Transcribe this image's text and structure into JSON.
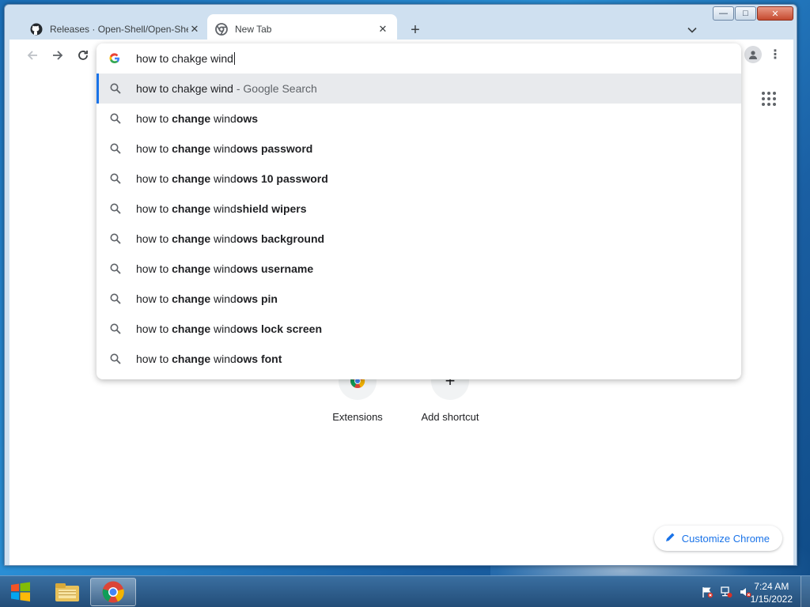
{
  "window": {
    "tabs": [
      {
        "title": "Releases · Open-Shell/Open-She",
        "icon": "github-icon",
        "active": false
      },
      {
        "title": "New Tab",
        "icon": "chrome-icon",
        "active": true
      }
    ],
    "caption": {
      "minimize": "—",
      "maximize": "□",
      "close": "✕"
    }
  },
  "omnibox": {
    "text": "how to chakge wind",
    "suggestions": [
      {
        "plain": "how to chakge wind",
        "bold": "",
        "tail": "",
        "suffix": " - Google Search",
        "selected": true
      },
      {
        "plain": "how to ",
        "bold": "change",
        "tail": " wind",
        "suffix_bold": "ows"
      },
      {
        "plain": "how to ",
        "bold": "change",
        "tail": " wind",
        "suffix_bold": "ows password"
      },
      {
        "plain": "how to ",
        "bold": "change",
        "tail": " wind",
        "suffix_bold": "ows 10 password"
      },
      {
        "plain": "how to ",
        "bold": "change",
        "tail": " wind",
        "suffix_bold": "shield wipers"
      },
      {
        "plain": "how to ",
        "bold": "change",
        "tail": " wind",
        "suffix_bold": "ows background"
      },
      {
        "plain": "how to ",
        "bold": "change",
        "tail": " wind",
        "suffix_bold": "ows username"
      },
      {
        "plain": "how to ",
        "bold": "change",
        "tail": " wind",
        "suffix_bold": "ows pin"
      },
      {
        "plain": "how to ",
        "bold": "change",
        "tail": " wind",
        "suffix_bold": "ows lock screen"
      },
      {
        "plain": "how to ",
        "bold": "change",
        "tail": " wind",
        "suffix_bold": "ows font"
      }
    ]
  },
  "newtab": {
    "shortcuts": [
      {
        "label": "Extensions",
        "icon": "chrome-icon"
      },
      {
        "label": "Add shortcut",
        "icon": "plus-icon"
      }
    ],
    "customize_label": "Customize Chrome"
  },
  "taskbar": {
    "time": "7:24 AM",
    "date": "1/15/2022",
    "apps": [
      "file-explorer-icon",
      "chrome-icon"
    ]
  },
  "colors": {
    "accent": "#1a73e8",
    "selected_row": "#e8eaed",
    "taskbar": "#2b5a88"
  }
}
